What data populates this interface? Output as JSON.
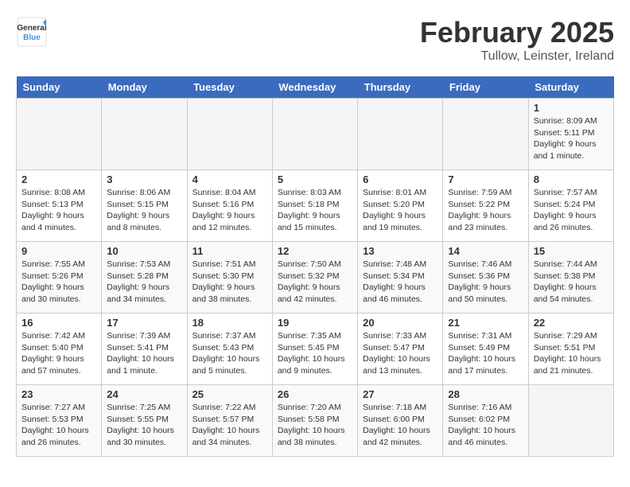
{
  "logo": {
    "general": "General",
    "blue": "Blue"
  },
  "title": "February 2025",
  "subtitle": "Tullow, Leinster, Ireland",
  "days_of_week": [
    "Sunday",
    "Monday",
    "Tuesday",
    "Wednesday",
    "Thursday",
    "Friday",
    "Saturday"
  ],
  "weeks": [
    [
      {
        "day": "",
        "info": ""
      },
      {
        "day": "",
        "info": ""
      },
      {
        "day": "",
        "info": ""
      },
      {
        "day": "",
        "info": ""
      },
      {
        "day": "",
        "info": ""
      },
      {
        "day": "",
        "info": ""
      },
      {
        "day": "1",
        "info": "Sunrise: 8:09 AM\nSunset: 5:11 PM\nDaylight: 9 hours and 1 minute."
      }
    ],
    [
      {
        "day": "2",
        "info": "Sunrise: 8:08 AM\nSunset: 5:13 PM\nDaylight: 9 hours and 4 minutes."
      },
      {
        "day": "3",
        "info": "Sunrise: 8:06 AM\nSunset: 5:15 PM\nDaylight: 9 hours and 8 minutes."
      },
      {
        "day": "4",
        "info": "Sunrise: 8:04 AM\nSunset: 5:16 PM\nDaylight: 9 hours and 12 minutes."
      },
      {
        "day": "5",
        "info": "Sunrise: 8:03 AM\nSunset: 5:18 PM\nDaylight: 9 hours and 15 minutes."
      },
      {
        "day": "6",
        "info": "Sunrise: 8:01 AM\nSunset: 5:20 PM\nDaylight: 9 hours and 19 minutes."
      },
      {
        "day": "7",
        "info": "Sunrise: 7:59 AM\nSunset: 5:22 PM\nDaylight: 9 hours and 23 minutes."
      },
      {
        "day": "8",
        "info": "Sunrise: 7:57 AM\nSunset: 5:24 PM\nDaylight: 9 hours and 26 minutes."
      }
    ],
    [
      {
        "day": "9",
        "info": "Sunrise: 7:55 AM\nSunset: 5:26 PM\nDaylight: 9 hours and 30 minutes."
      },
      {
        "day": "10",
        "info": "Sunrise: 7:53 AM\nSunset: 5:28 PM\nDaylight: 9 hours and 34 minutes."
      },
      {
        "day": "11",
        "info": "Sunrise: 7:51 AM\nSunset: 5:30 PM\nDaylight: 9 hours and 38 minutes."
      },
      {
        "day": "12",
        "info": "Sunrise: 7:50 AM\nSunset: 5:32 PM\nDaylight: 9 hours and 42 minutes."
      },
      {
        "day": "13",
        "info": "Sunrise: 7:48 AM\nSunset: 5:34 PM\nDaylight: 9 hours and 46 minutes."
      },
      {
        "day": "14",
        "info": "Sunrise: 7:46 AM\nSunset: 5:36 PM\nDaylight: 9 hours and 50 minutes."
      },
      {
        "day": "15",
        "info": "Sunrise: 7:44 AM\nSunset: 5:38 PM\nDaylight: 9 hours and 54 minutes."
      }
    ],
    [
      {
        "day": "16",
        "info": "Sunrise: 7:42 AM\nSunset: 5:40 PM\nDaylight: 9 hours and 57 minutes."
      },
      {
        "day": "17",
        "info": "Sunrise: 7:39 AM\nSunset: 5:41 PM\nDaylight: 10 hours and 1 minute."
      },
      {
        "day": "18",
        "info": "Sunrise: 7:37 AM\nSunset: 5:43 PM\nDaylight: 10 hours and 5 minutes."
      },
      {
        "day": "19",
        "info": "Sunrise: 7:35 AM\nSunset: 5:45 PM\nDaylight: 10 hours and 9 minutes."
      },
      {
        "day": "20",
        "info": "Sunrise: 7:33 AM\nSunset: 5:47 PM\nDaylight: 10 hours and 13 minutes."
      },
      {
        "day": "21",
        "info": "Sunrise: 7:31 AM\nSunset: 5:49 PM\nDaylight: 10 hours and 17 minutes."
      },
      {
        "day": "22",
        "info": "Sunrise: 7:29 AM\nSunset: 5:51 PM\nDaylight: 10 hours and 21 minutes."
      }
    ],
    [
      {
        "day": "23",
        "info": "Sunrise: 7:27 AM\nSunset: 5:53 PM\nDaylight: 10 hours and 26 minutes."
      },
      {
        "day": "24",
        "info": "Sunrise: 7:25 AM\nSunset: 5:55 PM\nDaylight: 10 hours and 30 minutes."
      },
      {
        "day": "25",
        "info": "Sunrise: 7:22 AM\nSunset: 5:57 PM\nDaylight: 10 hours and 34 minutes."
      },
      {
        "day": "26",
        "info": "Sunrise: 7:20 AM\nSunset: 5:58 PM\nDaylight: 10 hours and 38 minutes."
      },
      {
        "day": "27",
        "info": "Sunrise: 7:18 AM\nSunset: 6:00 PM\nDaylight: 10 hours and 42 minutes."
      },
      {
        "day": "28",
        "info": "Sunrise: 7:16 AM\nSunset: 6:02 PM\nDaylight: 10 hours and 46 minutes."
      },
      {
        "day": "",
        "info": ""
      }
    ]
  ]
}
